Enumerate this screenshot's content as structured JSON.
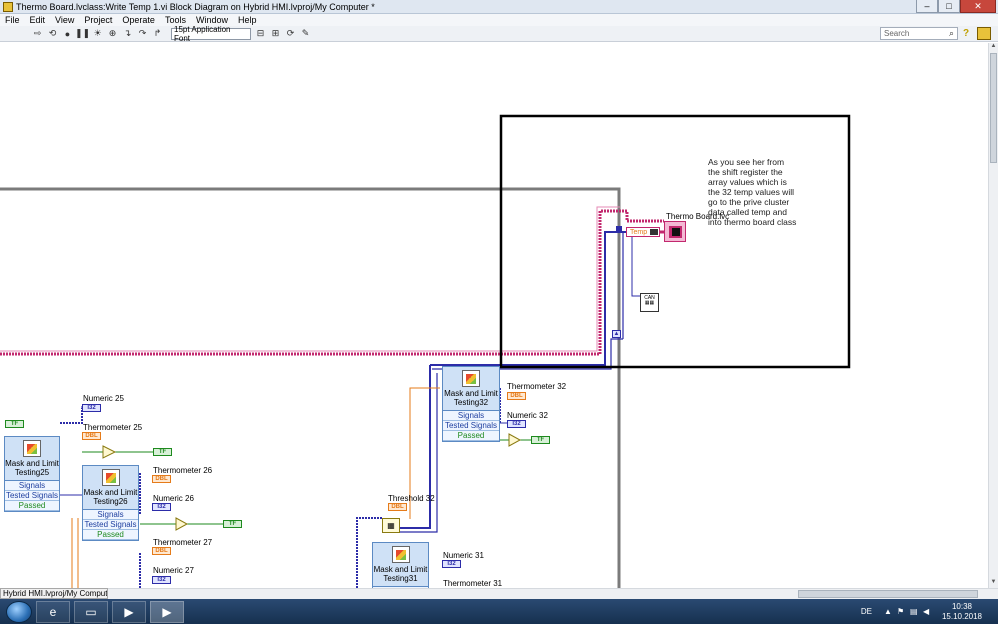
{
  "window": {
    "title": "Thermo Board.lvclass:Write Temp 1.vi Block Diagram on Hybrid HMI.lvproj/My Computer *",
    "minimize": "–",
    "maximize": "□",
    "close": "✕"
  },
  "menu": [
    "File",
    "Edit",
    "View",
    "Project",
    "Operate",
    "Tools",
    "Window",
    "Help"
  ],
  "toolbar": {
    "font": "15pt Application Font",
    "search_placeholder": "Search",
    "help": "?"
  },
  "context_label": "Hybrid HMI.lvproj/My Computer",
  "note": "As you see her from the shift register the array values which is the 32 temp values will go to the prive cluster data called temp and into thermo board class",
  "diagram": {
    "class_label": "Thermo Board.lvc",
    "temp_label": "Temp",
    "labels": {
      "numeric25": "Numeric 25",
      "thermometer25": "Thermometer 25",
      "thermometer26": "Thermometer 26",
      "numeric26": "Numeric 26",
      "thermometer27": "Thermometer 27",
      "numeric27": "Numeric 27",
      "thermometer32": "Thermometer 32",
      "numeric32": "Numeric 32",
      "threshold32": "Threshold 32",
      "numeric31": "Numeric 31",
      "thermometer31": "Thermometer 31"
    },
    "vis": {
      "mlt25": "Mask and Limit Testing25",
      "mlt26": "Mask and Limit Testing26",
      "mlt32": "Mask and Limit Testing32",
      "mlt31": "Mask and Limit Testing31"
    },
    "vi_rows": {
      "signals": "Signals",
      "tested": "Tested Signals",
      "passed": "Passed"
    },
    "terminal_types": {
      "i32": "I32",
      "dbl": "DBL",
      "tf": "TF"
    }
  },
  "taskbar": {
    "lang": "DE",
    "time": "10:38",
    "date": "15.10.2018"
  },
  "colors": {
    "cluster_wire": "#c2286e",
    "int_wire": "#2c2ca8",
    "dbl_wire": "#e57b1a",
    "bool_wire": "#1e8a1e",
    "structure": "#7b7b7b"
  }
}
